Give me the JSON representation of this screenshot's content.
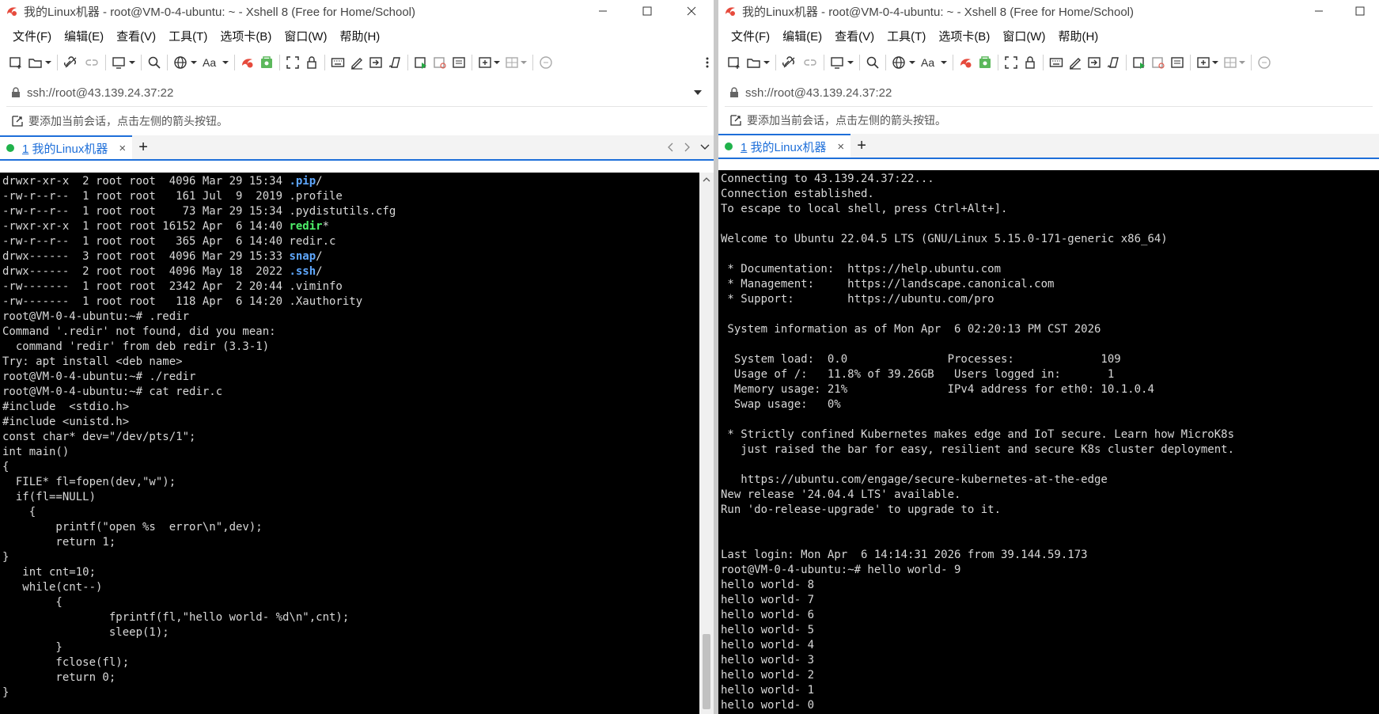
{
  "left": {
    "title": "我的Linux机器 - root@VM-0-4-ubuntu: ~ - Xshell 8 (Free for Home/School)",
    "menu": [
      "文件(F)",
      "编辑(E)",
      "查看(V)",
      "工具(T)",
      "选项卡(B)",
      "窗口(W)",
      "帮助(H)"
    ],
    "address": "ssh://root@43.139.24.37:22",
    "hint": "要添加当前会话，点击左侧的箭头按钮。",
    "tab": {
      "num": "1",
      "label": " 我的Linux机器",
      "close": "×"
    },
    "tab_add": "+",
    "terminal": [
      [
        [
          "drwxr-xr-x  2 root root  4096 Mar 29 15:34 ",
          ""
        ],
        [
          ".pip",
          "dir"
        ],
        [
          "/",
          ""
        ]
      ],
      [
        [
          "-rw-r--r--  1 root root   161 Jul  9  2019 .profile",
          ""
        ]
      ],
      [
        [
          "-rw-r--r--  1 root root    73 Mar 29 15:34 .pydistutils.cfg",
          ""
        ]
      ],
      [
        [
          "-rwxr-xr-x  1 root root 16152 Apr  6 14:40 ",
          ""
        ],
        [
          "redir",
          "exe"
        ],
        [
          "*",
          ""
        ]
      ],
      [
        [
          "-rw-r--r--  1 root root   365 Apr  6 14:40 redir.c",
          ""
        ]
      ],
      [
        [
          "drwx------  3 root root  4096 Mar 29 15:33 ",
          ""
        ],
        [
          "snap",
          "dir"
        ],
        [
          "/",
          ""
        ]
      ],
      [
        [
          "drwx------  2 root root  4096 May 18  2022 ",
          ""
        ],
        [
          ".ssh",
          "dir"
        ],
        [
          "/",
          ""
        ]
      ],
      [
        [
          "-rw-------  1 root root  2342 Apr  2 20:44 .viminfo",
          ""
        ]
      ],
      [
        [
          "-rw-------  1 root root   118 Apr  6 14:20 .Xauthority",
          ""
        ]
      ],
      [
        [
          "root@VM-0-4-ubuntu:~# .redir",
          ""
        ]
      ],
      [
        [
          "Command '.redir' not found, did you mean:",
          ""
        ]
      ],
      [
        [
          "  command 'redir' from deb redir (3.3-1)",
          ""
        ]
      ],
      [
        [
          "Try: apt install <deb name>",
          ""
        ]
      ],
      [
        [
          "root@VM-0-4-ubuntu:~# ./redir",
          ""
        ]
      ],
      [
        [
          "root@VM-0-4-ubuntu:~# cat redir.c",
          ""
        ]
      ],
      [
        [
          "#include  <stdio.h>",
          ""
        ]
      ],
      [
        [
          "#include <unistd.h>",
          ""
        ]
      ],
      [
        [
          "const char* dev=\"/dev/pts/1\";",
          ""
        ]
      ],
      [
        [
          "int main()",
          ""
        ]
      ],
      [
        [
          "{",
          ""
        ]
      ],
      [
        [
          "  FILE* fl=fopen(dev,\"w\");",
          ""
        ]
      ],
      [
        [
          "  if(fl==NULL)",
          ""
        ]
      ],
      [
        [
          "    {",
          ""
        ]
      ],
      [
        [
          "        printf(\"open %s  error\\n\",dev);",
          ""
        ]
      ],
      [
        [
          "        return 1;",
          ""
        ]
      ],
      [
        [
          "}",
          ""
        ]
      ],
      [
        [
          "   int cnt=10;",
          ""
        ]
      ],
      [
        [
          "   while(cnt--)",
          ""
        ]
      ],
      [
        [
          "        {",
          ""
        ]
      ],
      [
        [
          "                fprintf(fl,\"hello world- %d\\n\",cnt);",
          ""
        ]
      ],
      [
        [
          "                sleep(1);",
          ""
        ]
      ],
      [
        [
          "        }",
          ""
        ]
      ],
      [
        [
          "        fclose(fl);",
          ""
        ]
      ],
      [
        [
          "        return 0;",
          ""
        ]
      ],
      [
        [
          "}",
          ""
        ]
      ]
    ]
  },
  "right": {
    "title": "我的Linux机器 - root@VM-0-4-ubuntu: ~ - Xshell 8 (Free for Home/School)",
    "menu": [
      "文件(F)",
      "编辑(E)",
      "查看(V)",
      "工具(T)",
      "选项卡(B)",
      "窗口(W)",
      "帮助(H)"
    ],
    "address": "ssh://root@43.139.24.37:22",
    "hint": "要添加当前会话，点击左侧的箭头按钮。",
    "tab": {
      "num": "1",
      "label": " 我的Linux机器",
      "close": "×"
    },
    "tab_add": "+",
    "terminal": [
      [
        [
          "Connecting to 43.139.24.37:22...",
          ""
        ]
      ],
      [
        [
          "Connection established.",
          ""
        ]
      ],
      [
        [
          "To escape to local shell, press Ctrl+Alt+].",
          ""
        ]
      ],
      [
        [
          "",
          ""
        ]
      ],
      [
        [
          "Welcome to Ubuntu 22.04.5 LTS (GNU/Linux 5.15.0-171-generic x86_64)",
          ""
        ]
      ],
      [
        [
          "",
          ""
        ]
      ],
      [
        [
          " * Documentation:  https://help.ubuntu.com",
          ""
        ]
      ],
      [
        [
          " * Management:     https://landscape.canonical.com",
          ""
        ]
      ],
      [
        [
          " * Support:        https://ubuntu.com/pro",
          ""
        ]
      ],
      [
        [
          "",
          ""
        ]
      ],
      [
        [
          " System information as of Mon Apr  6 02:20:13 PM CST 2026",
          ""
        ]
      ],
      [
        [
          "",
          ""
        ]
      ],
      [
        [
          "  System load:  0.0               Processes:             109",
          ""
        ]
      ],
      [
        [
          "  Usage of /:   11.8% of 39.26GB   Users logged in:       1",
          ""
        ]
      ],
      [
        [
          "  Memory usage: 21%               IPv4 address for eth0: 10.1.0.4",
          ""
        ]
      ],
      [
        [
          "  Swap usage:   0%",
          ""
        ]
      ],
      [
        [
          "",
          ""
        ]
      ],
      [
        [
          " * Strictly confined Kubernetes makes edge and IoT secure. Learn how MicroK8s",
          ""
        ]
      ],
      [
        [
          "   just raised the bar for easy, resilient and secure K8s cluster deployment.",
          ""
        ]
      ],
      [
        [
          "",
          ""
        ]
      ],
      [
        [
          "   https://ubuntu.com/engage/secure-kubernetes-at-the-edge",
          ""
        ]
      ],
      [
        [
          "New release '24.04.4 LTS' available.",
          ""
        ]
      ],
      [
        [
          "Run 'do-release-upgrade' to upgrade to it.",
          ""
        ]
      ],
      [
        [
          "",
          ""
        ]
      ],
      [
        [
          "",
          ""
        ]
      ],
      [
        [
          "Last login: Mon Apr  6 14:14:31 2026 from 39.144.59.173",
          ""
        ]
      ],
      [
        [
          "root@VM-0-4-ubuntu:~# hello world- 9",
          ""
        ]
      ],
      [
        [
          "hello world- 8",
          ""
        ]
      ],
      [
        [
          "hello world- 7",
          ""
        ]
      ],
      [
        [
          "hello world- 6",
          ""
        ]
      ],
      [
        [
          "hello world- 5",
          ""
        ]
      ],
      [
        [
          "hello world- 4",
          ""
        ]
      ],
      [
        [
          "hello world- 3",
          ""
        ]
      ],
      [
        [
          "hello world- 2",
          ""
        ]
      ],
      [
        [
          "hello world- 1",
          ""
        ]
      ],
      [
        [
          "hello world- 0",
          ""
        ]
      ]
    ]
  },
  "colors": {
    "tab_accent": "#1e6fd9",
    "session_dot": "#20b24b",
    "terminal_bg": "#000000",
    "terminal_fg": "#d8d8d8",
    "dir_color": "#5fa8ff",
    "exe_color": "#4ef06a"
  },
  "icons": [
    "app-logo-icon",
    "minimize-icon",
    "maximize-icon",
    "close-icon",
    "new-session-icon",
    "open-folder-icon",
    "connect-icon",
    "disconnect-icon",
    "reconnect-icon",
    "find-icon",
    "globe-icon",
    "font-icon",
    "xftp-icon",
    "xshell-session-icon",
    "fullscreen-icon",
    "lock-icon",
    "keyboard-icon",
    "pen-icon",
    "transfer-icon",
    "script-icon",
    "play-icon",
    "log-icon",
    "compose-icon",
    "new-tab-icon",
    "layout-icon",
    "chat-icon",
    "more-icon",
    "scroll-up-icon"
  ]
}
